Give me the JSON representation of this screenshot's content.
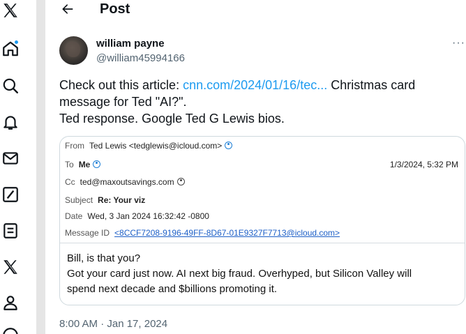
{
  "header": {
    "title": "Post"
  },
  "nav": {
    "items": [
      "x-logo",
      "home",
      "explore",
      "notifications",
      "messages",
      "grok",
      "lists",
      "premium",
      "profile",
      "more"
    ]
  },
  "tweet": {
    "display_name": "william payne",
    "handle": "@william45994166",
    "more": "···",
    "text_prefix": "Check out this article: ",
    "link_text": "cnn.com/2024/01/16/tec...",
    "text_suffix": " Christmas card",
    "line2": "message for Ted \"AI?\".",
    "line3": "Ted response.  Google Ted G Lewis bios.",
    "timestamp": "8:00 AM · Jan 17, 2024"
  },
  "email": {
    "from_label": "From",
    "from_value": "Ted Lewis <tedglewis@icloud.com>",
    "to_label": "To",
    "to_value": "Me",
    "date_right": "1/3/2024, 5:32 PM",
    "cc_label": "Cc",
    "cc_value": "ted@maxoutsavings.com",
    "subject_label": "Subject",
    "subject_value": "Re: Your viz",
    "date_label": "Date",
    "date_value": "Wed, 3 Jan 2024 16:32:42 -0800",
    "msgid_label": "Message ID",
    "msgid_value": "<8CCF7208-9196-49FF-8D67-01E9327F7713@icloud.com>",
    "body_line1": "Bill, is that you?",
    "body_line2": "Got your card just now. AI next big fraud. Overhyped, but Silicon Valley will",
    "body_line3": "spend next decade and $billions promoting it."
  },
  "colors": {
    "link": "#1d9bf0",
    "notification_dot": "#1d9bf0",
    "text": "#0f1419",
    "secondary": "#536471"
  }
}
